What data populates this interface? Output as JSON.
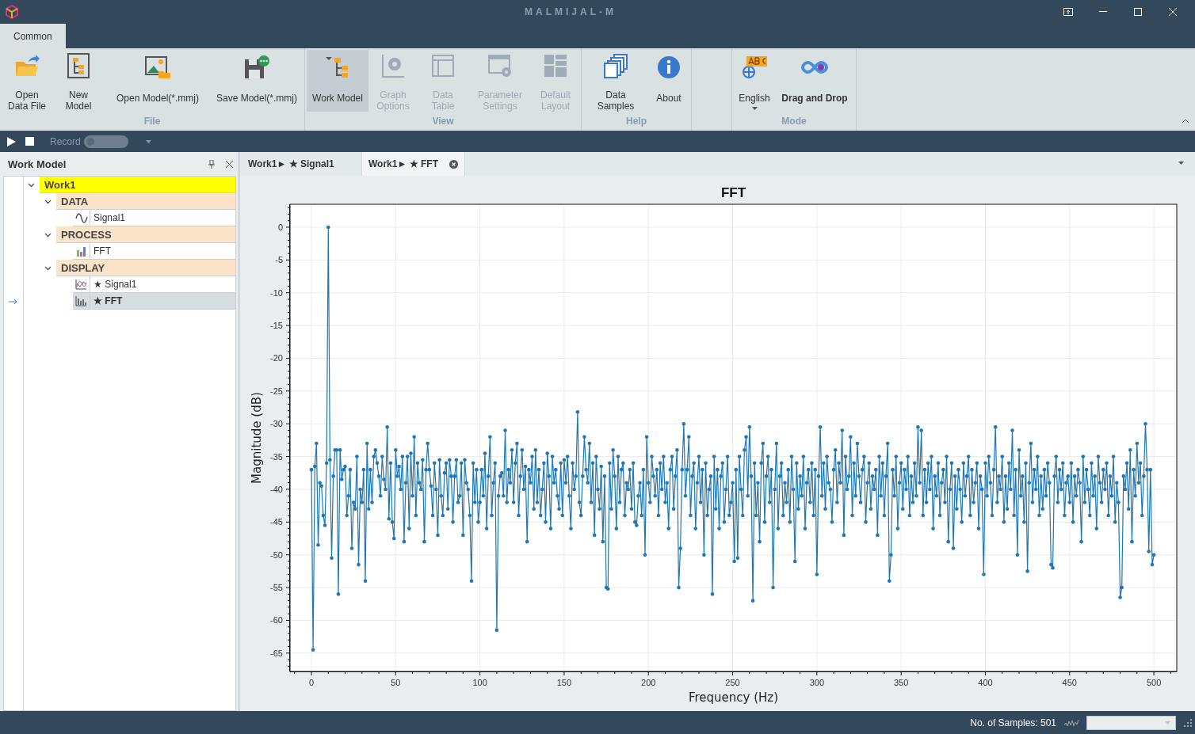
{
  "window": {
    "title": "MALMIJAL-M"
  },
  "ribbon_tabs": [
    {
      "label": "Common",
      "selected": true
    }
  ],
  "ribbon_groups": [
    {
      "label": "File",
      "buttons": [
        {
          "label": "Open Data File",
          "disabled": false,
          "pressed": false
        },
        {
          "label": "New Model",
          "disabled": false,
          "pressed": false
        },
        {
          "label": "Open Model(*.mmj)",
          "disabled": false,
          "pressed": false
        },
        {
          "label": "Save Model(*.mmj)",
          "disabled": false,
          "pressed": false
        }
      ]
    },
    {
      "label": "View",
      "buttons": [
        {
          "label": "Work Model",
          "disabled": false,
          "pressed": true
        },
        {
          "label": "Graph Options",
          "disabled": true,
          "pressed": false
        },
        {
          "label": "Data Table",
          "disabled": true,
          "pressed": false
        },
        {
          "label": "Parameter Settings",
          "disabled": true,
          "pressed": false
        },
        {
          "label": "Default Layout",
          "disabled": true,
          "pressed": false
        }
      ]
    },
    {
      "label": "Help",
      "buttons": [
        {
          "label": "Data Samples",
          "disabled": false,
          "pressed": false
        },
        {
          "label": "About",
          "disabled": false,
          "pressed": false
        }
      ]
    },
    {
      "label": "Mode",
      "buttons": [
        {
          "label": "English",
          "disabled": false,
          "pressed": false,
          "dropdown": true
        },
        {
          "label": "Drag and Drop",
          "disabled": false,
          "pressed": false,
          "checked": true
        }
      ]
    }
  ],
  "toolbar": {
    "record": {
      "label": "Record",
      "on": false
    }
  },
  "work_model_panel": {
    "title": "Work Model",
    "tree": [
      {
        "label": "Work1",
        "kind": "root",
        "expanded": true,
        "children": [
          {
            "label": "DATA",
            "kind": "group",
            "expanded": true,
            "children": [
              {
                "label": "Signal1",
                "kind": "signal",
                "selected": false
              }
            ]
          },
          {
            "label": "PROCESS",
            "kind": "group",
            "expanded": true,
            "children": [
              {
                "label": "FFT",
                "kind": "fft",
                "selected": false
              }
            ]
          },
          {
            "label": "DISPLAY",
            "kind": "group",
            "expanded": true,
            "children": [
              {
                "label": "★ Signal1",
                "kind": "signal-plot",
                "selected": false
              },
              {
                "label": "★ FFT",
                "kind": "fft-plot",
                "selected": true
              }
            ]
          }
        ]
      }
    ]
  },
  "document_tabs": [
    {
      "label": "Work1► ★ Signal1",
      "selected": false
    },
    {
      "label": "Work1► ★ FFT",
      "selected": true
    }
  ],
  "chart": {
    "chart_data": {
      "type": "line",
      "title": "FFT",
      "xlabel": "Frequency (Hz)",
      "ylabel": "Magnitude (dB)",
      "xlim": [
        -12.7,
        513.6
      ],
      "ylim": [
        -67.8,
        3.5
      ],
      "xticks": [
        0,
        50,
        100,
        150,
        200,
        250,
        300,
        350,
        400,
        450,
        500
      ],
      "yticks": [
        0,
        -5,
        -10,
        -15,
        -20,
        -25,
        -30,
        -35,
        -40,
        -45,
        -50,
        -55,
        -60,
        -65
      ],
      "x": [
        0,
        1,
        2,
        3,
        4,
        5,
        6,
        7,
        8,
        9,
        10,
        11,
        12,
        13,
        14,
        15,
        16,
        17,
        18,
        19,
        20,
        21,
        22,
        23,
        24,
        25,
        26,
        27,
        28,
        29,
        30,
        31,
        32,
        33,
        34,
        35,
        36,
        37,
        38,
        39,
        40,
        41,
        42,
        43,
        44,
        45,
        46,
        47,
        48,
        49,
        50,
        51,
        52,
        53,
        54,
        55,
        56,
        57,
        58,
        59,
        60,
        61,
        62,
        63,
        64,
        65,
        66,
        67,
        68,
        69,
        70,
        71,
        72,
        73,
        74,
        75,
        76,
        77,
        78,
        79,
        80,
        81,
        82,
        83,
        84,
        85,
        86,
        87,
        88,
        89,
        90,
        91,
        92,
        93,
        94,
        95,
        96,
        97,
        98,
        99,
        100,
        101,
        102,
        103,
        104,
        105,
        106,
        107,
        108,
        109,
        110,
        111,
        112,
        113,
        114,
        115,
        116,
        117,
        118,
        119,
        120,
        121,
        122,
        123,
        124,
        125,
        126,
        127,
        128,
        129,
        130,
        131,
        132,
        133,
        134,
        135,
        136,
        137,
        138,
        139,
        140,
        141,
        142,
        143,
        144,
        145,
        146,
        147,
        148,
        149,
        150,
        151,
        152,
        153,
        154,
        155,
        156,
        157,
        158,
        159,
        160,
        161,
        162,
        163,
        164,
        165,
        166,
        167,
        168,
        169,
        170,
        171,
        172,
        173,
        174,
        175,
        176,
        177,
        178,
        179,
        180,
        181,
        182,
        183,
        184,
        185,
        186,
        187,
        188,
        189,
        190,
        191,
        192,
        193,
        194,
        195,
        196,
        197,
        198,
        199,
        200,
        201,
        202,
        203,
        204,
        205,
        206,
        207,
        208,
        209,
        210,
        211,
        212,
        213,
        214,
        215,
        216,
        217,
        218,
        219,
        220,
        221,
        222,
        223,
        224,
        225,
        226,
        227,
        228,
        229,
        230,
        231,
        232,
        233,
        234,
        235,
        236,
        237,
        238,
        239,
        240,
        241,
        242,
        243,
        244,
        245,
        246,
        247,
        248,
        249,
        250,
        251,
        252,
        253,
        254,
        255,
        256,
        257,
        258,
        259,
        260,
        261,
        262,
        263,
        264,
        265,
        266,
        267,
        268,
        269,
        270,
        271,
        272,
        273,
        274,
        275,
        276,
        277,
        278,
        279,
        280,
        281,
        282,
        283,
        284,
        285,
        286,
        287,
        288,
        289,
        290,
        291,
        292,
        293,
        294,
        295,
        296,
        297,
        298,
        299,
        300,
        301,
        302,
        303,
        304,
        305,
        306,
        307,
        308,
        309,
        310,
        311,
        312,
        313,
        314,
        315,
        316,
        317,
        318,
        319,
        320,
        321,
        322,
        323,
        324,
        325,
        326,
        327,
        328,
        329,
        330,
        331,
        332,
        333,
        334,
        335,
        336,
        337,
        338,
        339,
        340,
        341,
        342,
        343,
        344,
        345,
        346,
        347,
        348,
        349,
        350,
        351,
        352,
        353,
        354,
        355,
        356,
        357,
        358,
        359,
        360,
        361,
        362,
        363,
        364,
        365,
        366,
        367,
        368,
        369,
        370,
        371,
        372,
        373,
        374,
        375,
        376,
        377,
        378,
        379,
        380,
        381,
        382,
        383,
        384,
        385,
        386,
        387,
        388,
        389,
        390,
        391,
        392,
        393,
        394,
        395,
        396,
        397,
        398,
        399,
        400,
        401,
        402,
        403,
        404,
        405,
        406,
        407,
        408,
        409,
        410,
        411,
        412,
        413,
        414,
        415,
        416,
        417,
        418,
        419,
        420,
        421,
        422,
        423,
        424,
        425,
        426,
        427,
        428,
        429,
        430,
        431,
        432,
        433,
        434,
        435,
        436,
        437,
        438,
        439,
        440,
        441,
        442,
        443,
        444,
        445,
        446,
        447,
        448,
        449,
        450,
        451,
        452,
        453,
        454,
        455,
        456,
        457,
        458,
        459,
        460,
        461,
        462,
        463,
        464,
        465,
        466,
        467,
        468,
        469,
        470,
        471,
        472,
        473,
        474,
        475,
        476,
        477,
        478,
        479,
        480,
        481,
        482,
        483,
        484,
        485,
        486,
        487,
        488,
        489,
        490,
        491,
        492,
        493,
        494,
        495,
        496,
        497,
        498,
        499,
        500
      ],
      "grid": true,
      "series": [
        {
          "color": "#1f77b4",
          "values": [
            -37,
            -64.5,
            -36.5,
            -33,
            -48.5,
            -39,
            -39.5,
            -44,
            -45.5,
            -36,
            0,
            -35.5,
            -50.5,
            -38,
            -34,
            -34,
            -56,
            -34,
            -38.5,
            -37,
            -36.5,
            -44,
            -41,
            -37,
            -49,
            -42,
            -43,
            -35,
            -51.5,
            -40,
            -42,
            -37,
            -54,
            -33,
            -43,
            -37,
            -42,
            -35,
            -34,
            -36,
            -38,
            -41,
            -35,
            -38.5,
            -40,
            -30.5,
            -44.5,
            -36,
            -45,
            -47.5,
            -34,
            -38,
            -36.5,
            -40,
            -35,
            -48,
            -39,
            -35,
            -46,
            -34.5,
            -41,
            -32,
            -44,
            -36,
            -39,
            -40,
            -35.5,
            -48,
            -37,
            -33,
            -37,
            -39.5,
            -44,
            -36,
            -40,
            -47,
            -35.5,
            -41,
            -44,
            -37.5,
            -36,
            -43,
            -35.5,
            -38,
            -45,
            -38,
            -35.5,
            -42,
            -41,
            -36,
            -47,
            -35.5,
            -39,
            -40,
            -44,
            -54,
            -36,
            -42,
            -37,
            -45,
            -42,
            -37,
            -41,
            -34.5,
            -46,
            -38,
            -32,
            -44,
            -39,
            -36,
            -61.5,
            -41,
            -38,
            -37.5,
            -41,
            -31,
            -42,
            -37,
            -39,
            -34,
            -42,
            -36,
            -33,
            -44,
            -38,
            -34,
            -40,
            -36.5,
            -48,
            -37,
            -39,
            -35,
            -43,
            -34,
            -42,
            -37,
            -44,
            -40,
            -36,
            -45,
            -34.5,
            -38,
            -46,
            -35,
            -39,
            -37,
            -41,
            -43,
            -36,
            -44,
            -35.5,
            -39,
            -35,
            -41,
            -46,
            -36,
            -40,
            -38,
            -28.2,
            -42,
            -44,
            -38,
            -32,
            -37,
            -39,
            -33,
            -42,
            -36,
            -47,
            -35,
            -40,
            -43,
            -36.5,
            -48,
            -38,
            -55,
            -55.2,
            -36,
            -43,
            -34,
            -38,
            -46,
            -35,
            -42,
            -37,
            -36,
            -44,
            -39,
            -40,
            -37,
            -43,
            -36,
            -45,
            -45.5,
            -41,
            -39,
            -44,
            -37,
            -50,
            -32,
            -39,
            -42,
            -35,
            -38,
            -41,
            -37,
            -44,
            -36,
            -40,
            -35,
            -42,
            -39,
            -46,
            -37,
            -35,
            -43,
            -38,
            -34,
            -55,
            -49,
            -37,
            -30,
            -41,
            -37,
            -32,
            -44,
            -38,
            -36,
            -46,
            -39,
            -35,
            -42,
            -37,
            -50,
            -36,
            -44,
            -40,
            -38,
            -56,
            -35,
            -43,
            -37,
            -46,
            -38,
            -36,
            -45,
            -40,
            -35,
            -44,
            -42,
            -39,
            -51,
            -37,
            -50.5,
            -35,
            -40,
            -44,
            -34,
            -32,
            -41,
            -30.5,
            -38,
            -57,
            -36,
            -44,
            -39,
            -48,
            -36,
            -33,
            -45,
            -38,
            -35,
            -42,
            -37,
            -55,
            -40,
            -33,
            -46,
            -38,
            -36,
            -44,
            -39,
            -42,
            -37,
            -45,
            -35,
            -40,
            -51,
            -36,
            -43,
            -38,
            -41,
            -35,
            -46,
            -39,
            -37,
            -42,
            -36,
            -44,
            -37,
            -53,
            -38,
            -30.5,
            -41,
            -36,
            -43,
            -35,
            -39,
            -40,
            -45,
            -37,
            -34,
            -42,
            -36,
            -39,
            -31,
            -47,
            -35,
            -40,
            -38,
            -32,
            -44,
            -36,
            -41,
            -33,
            -38,
            -42,
            -37,
            -35,
            -45,
            -39,
            -36,
            -43,
            -38,
            -40,
            -37,
            -47,
            -35,
            -41,
            -36,
            -44,
            -38,
            -33,
            -54,
            -50,
            -37,
            -41,
            -35,
            -46,
            -39,
            -36,
            -43,
            -37,
            -40,
            -35,
            -44,
            -38,
            -42,
            -36,
            -41,
            -30.5,
            -39,
            -31,
            -44,
            -37,
            -42,
            -36,
            -40,
            -35,
            -46,
            -38,
            -41,
            -36,
            -44,
            -39,
            -37,
            -42,
            -35,
            -48,
            -40,
            -36,
            -49,
            -38,
            -43,
            -37,
            -40,
            -45,
            -36,
            -41,
            -38,
            -35,
            -44,
            -37,
            -42,
            -39,
            -36,
            -46,
            -38,
            -40,
            -53,
            -36,
            -41,
            -35,
            -39,
            -44,
            -37,
            -30.5,
            -42,
            -38,
            -40,
            -35,
            -45,
            -38,
            -43,
            -36,
            -40,
            -31,
            -44,
            -37,
            -50,
            -34,
            -41,
            -38,
            -45,
            -36,
            -52.5,
            -39,
            -33,
            -42,
            -37,
            -40,
            -35,
            -44,
            -38,
            -43,
            -37,
            -41,
            -36,
            -39,
            -51.5,
            -52,
            -38,
            -35,
            -42,
            -37,
            -40,
            -36,
            -44,
            -39,
            -38,
            -42,
            -36,
            -45,
            -38,
            -41,
            -37,
            -39,
            -48,
            -35,
            -42,
            -37,
            -40,
            -44,
            -36,
            -41,
            -38,
            -46,
            -35,
            -39,
            -42,
            -37,
            -40,
            -36,
            -44,
            -38,
            -41,
            -35,
            -45,
            -39,
            -42,
            -56.5,
            -55,
            -38,
            -40,
            -36,
            -43,
            -34,
            -48,
            -37,
            -41,
            -33,
            -39,
            -36,
            -44,
            -38,
            -30,
            -37,
            -49.5,
            -37,
            -51.5,
            -50
          ]
        }
      ]
    }
  },
  "status_bar": {
    "samples": "No. of Samples: 501"
  }
}
